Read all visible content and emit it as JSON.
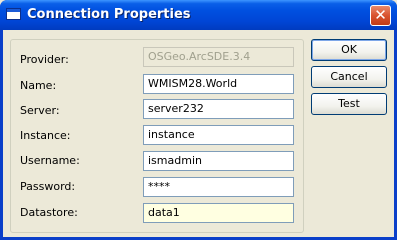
{
  "window": {
    "title": "Connection Properties",
    "close_glyph": "✕",
    "icon": "window-icon"
  },
  "form": {
    "fields": [
      {
        "label": "Provider:",
        "value": "OSGeo.ArcSDE.3.4",
        "state": "disabled"
      },
      {
        "label": "Name:",
        "value": "WMISM28.World",
        "state": "normal"
      },
      {
        "label": "Server:",
        "value": "server232",
        "state": "normal"
      },
      {
        "label": "Instance:",
        "value": "instance",
        "state": "normal"
      },
      {
        "label": "Username:",
        "value": "ismadmin",
        "state": "normal"
      },
      {
        "label": "Password:",
        "value": "****",
        "state": "normal"
      },
      {
        "label": "Datastore:",
        "value": "data1",
        "state": "highlighted"
      }
    ]
  },
  "buttons": {
    "ok": "OK",
    "cancel": "Cancel",
    "test": "Test"
  }
}
